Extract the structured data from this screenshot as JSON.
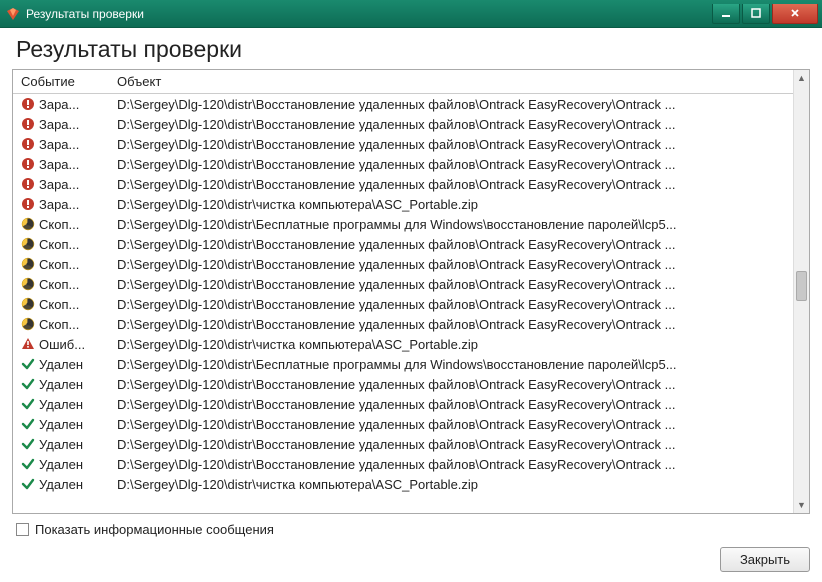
{
  "window": {
    "title": "Результаты проверки"
  },
  "page": {
    "heading": "Результаты проверки"
  },
  "columns": {
    "event": "Событие",
    "object": "Объект"
  },
  "rows": [
    {
      "icon": "infected",
      "event": "Зара...",
      "object": "D:\\Sergey\\Dlg-120\\distr\\Восстановление удаленных файлов\\Ontrack EasyRecovery\\Ontrack ..."
    },
    {
      "icon": "infected",
      "event": "Зара...",
      "object": "D:\\Sergey\\Dlg-120\\distr\\Восстановление удаленных файлов\\Ontrack EasyRecovery\\Ontrack ..."
    },
    {
      "icon": "infected",
      "event": "Зара...",
      "object": "D:\\Sergey\\Dlg-120\\distr\\Восстановление удаленных файлов\\Ontrack EasyRecovery\\Ontrack ..."
    },
    {
      "icon": "infected",
      "event": "Зара...",
      "object": "D:\\Sergey\\Dlg-120\\distr\\Восстановление удаленных файлов\\Ontrack EasyRecovery\\Ontrack ..."
    },
    {
      "icon": "infected",
      "event": "Зара...",
      "object": "D:\\Sergey\\Dlg-120\\distr\\Восстановление удаленных файлов\\Ontrack EasyRecovery\\Ontrack ..."
    },
    {
      "icon": "infected",
      "event": "Зара...",
      "object": "D:\\Sergey\\Dlg-120\\distr\\чистка компьютера\\ASC_Portable.zip"
    },
    {
      "icon": "riskware",
      "event": "Скоп...",
      "object": "D:\\Sergey\\Dlg-120\\distr\\Бесплатные программы для Windows\\восстановление паролей\\lcp5..."
    },
    {
      "icon": "riskware",
      "event": "Скоп...",
      "object": "D:\\Sergey\\Dlg-120\\distr\\Восстановление удаленных файлов\\Ontrack EasyRecovery\\Ontrack ..."
    },
    {
      "icon": "riskware",
      "event": "Скоп...",
      "object": "D:\\Sergey\\Dlg-120\\distr\\Восстановление удаленных файлов\\Ontrack EasyRecovery\\Ontrack ..."
    },
    {
      "icon": "riskware",
      "event": "Скоп...",
      "object": "D:\\Sergey\\Dlg-120\\distr\\Восстановление удаленных файлов\\Ontrack EasyRecovery\\Ontrack ..."
    },
    {
      "icon": "riskware",
      "event": "Скоп...",
      "object": "D:\\Sergey\\Dlg-120\\distr\\Восстановление удаленных файлов\\Ontrack EasyRecovery\\Ontrack ..."
    },
    {
      "icon": "riskware",
      "event": "Скоп...",
      "object": "D:\\Sergey\\Dlg-120\\distr\\Восстановление удаленных файлов\\Ontrack EasyRecovery\\Ontrack ..."
    },
    {
      "icon": "error",
      "event": "Ошиб...",
      "object": "D:\\Sergey\\Dlg-120\\distr\\чистка компьютера\\ASC_Portable.zip"
    },
    {
      "icon": "deleted",
      "event": "Удален",
      "object": "D:\\Sergey\\Dlg-120\\distr\\Бесплатные программы для Windows\\восстановление паролей\\lcp5..."
    },
    {
      "icon": "deleted",
      "event": "Удален",
      "object": "D:\\Sergey\\Dlg-120\\distr\\Восстановление удаленных файлов\\Ontrack EasyRecovery\\Ontrack ..."
    },
    {
      "icon": "deleted",
      "event": "Удален",
      "object": "D:\\Sergey\\Dlg-120\\distr\\Восстановление удаленных файлов\\Ontrack EasyRecovery\\Ontrack ..."
    },
    {
      "icon": "deleted",
      "event": "Удален",
      "object": "D:\\Sergey\\Dlg-120\\distr\\Восстановление удаленных файлов\\Ontrack EasyRecovery\\Ontrack ..."
    },
    {
      "icon": "deleted",
      "event": "Удален",
      "object": "D:\\Sergey\\Dlg-120\\distr\\Восстановление удаленных файлов\\Ontrack EasyRecovery\\Ontrack ..."
    },
    {
      "icon": "deleted",
      "event": "Удален",
      "object": "D:\\Sergey\\Dlg-120\\distr\\Восстановление удаленных файлов\\Ontrack EasyRecovery\\Ontrack ..."
    },
    {
      "icon": "deleted",
      "event": "Удален",
      "object": "D:\\Sergey\\Dlg-120\\distr\\чистка компьютера\\ASC_Portable.zip"
    }
  ],
  "footer": {
    "checkbox_label": "Показать информационные сообщения",
    "close_button": "Закрыть"
  }
}
